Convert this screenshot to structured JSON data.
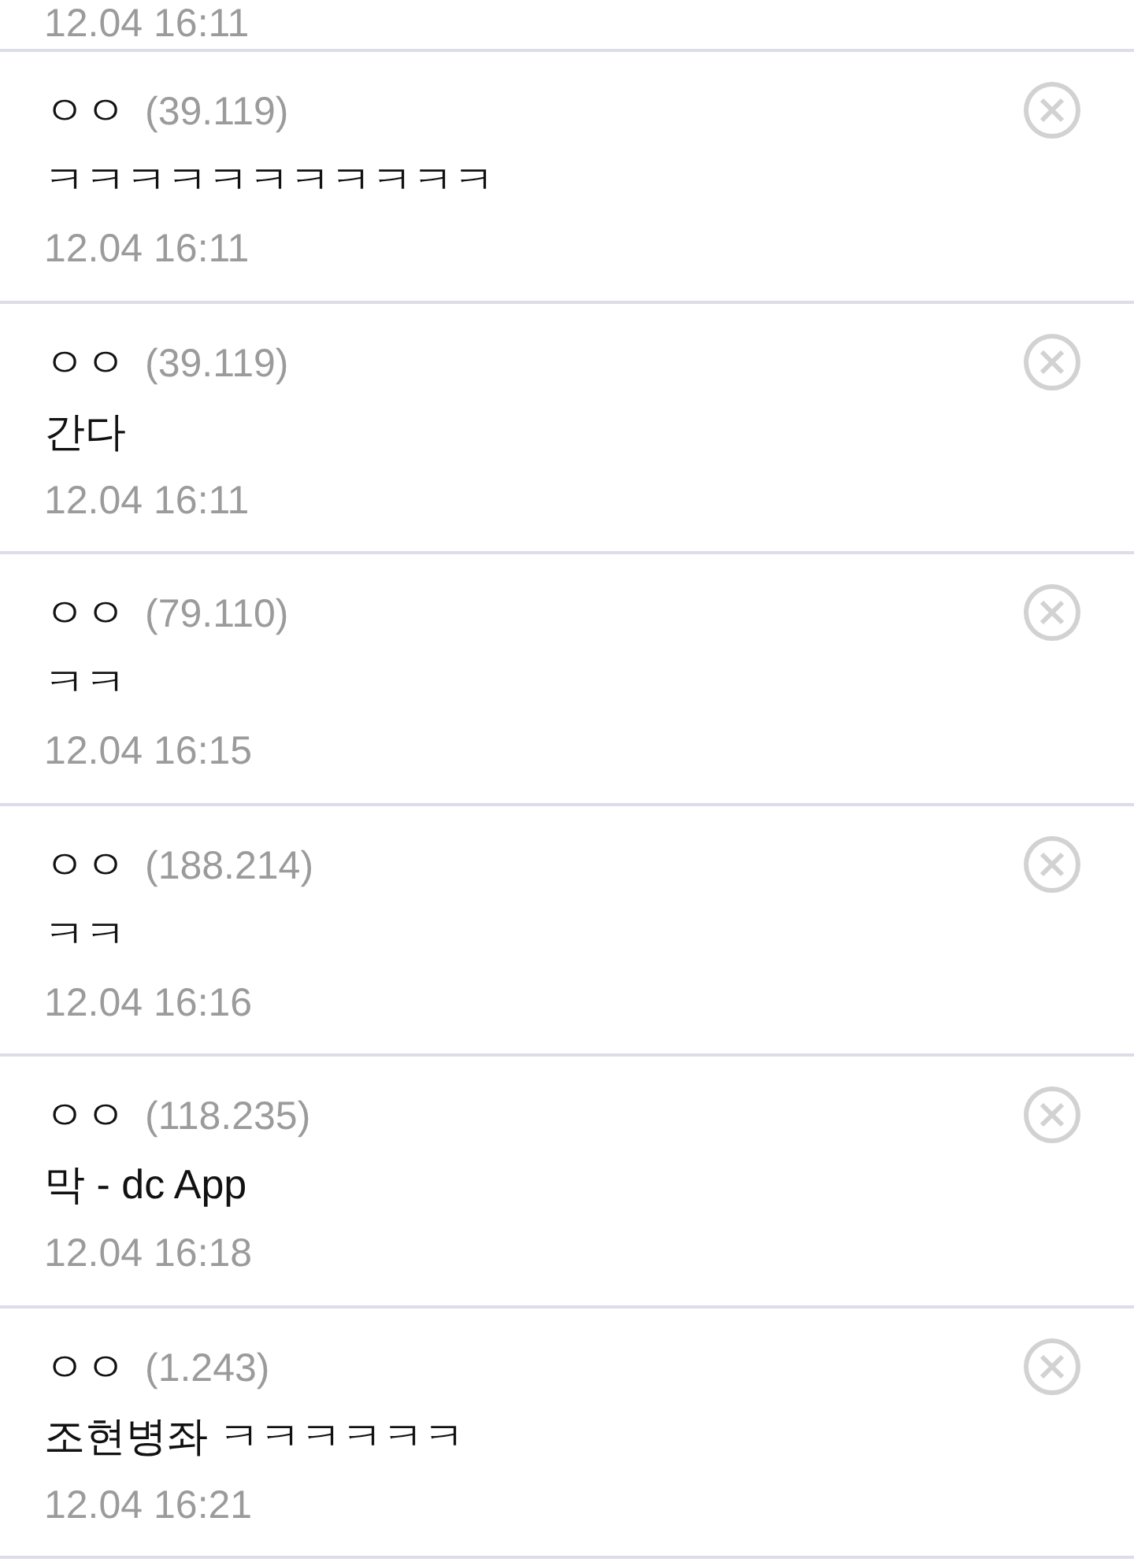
{
  "top_fragment": {
    "date": "12.04 16:11"
  },
  "comments": [
    {
      "author": "ㅇㅇ",
      "ip": "(39.119)",
      "text": "ㅋㅋㅋㅋㅋㅋㅋㅋㅋㅋㅋ",
      "date": "12.04 16:11"
    },
    {
      "author": "ㅇㅇ",
      "ip": "(39.119)",
      "text": "간다",
      "date": "12.04 16:11"
    },
    {
      "author": "ㅇㅇ",
      "ip": "(79.110)",
      "text": "ㅋㅋ",
      "date": "12.04 16:15"
    },
    {
      "author": "ㅇㅇ",
      "ip": "(188.214)",
      "text": "ㅋㅋ",
      "date": "12.04 16:16"
    },
    {
      "author": "ㅇㅇ",
      "ip": "(118.235)",
      "text": "막 - dc App",
      "date": "12.04 16:18"
    },
    {
      "author": "ㅇㅇ",
      "ip": "(1.243)",
      "text": "조현병좌 ㅋㅋㅋㅋㅋㅋ",
      "date": "12.04 16:21"
    }
  ]
}
